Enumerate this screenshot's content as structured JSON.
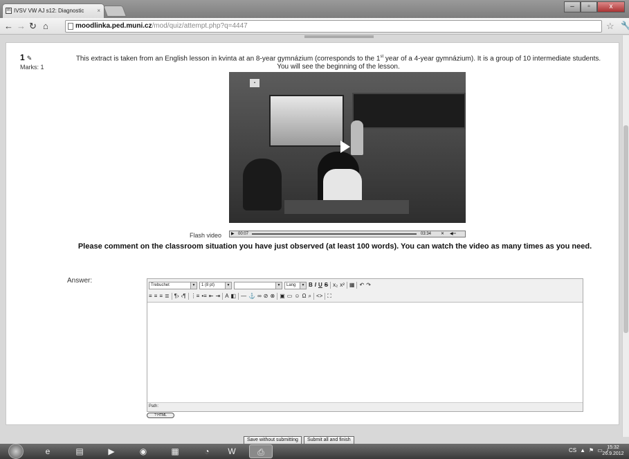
{
  "browser": {
    "tab_title": "IVSV VW AJ s12: Diagnostic",
    "tab_close": "×",
    "url_host": "moodlinka.ped.muni.cz",
    "url_path": "/mod/quiz/attempt.php?q=4447",
    "window_buttons": [
      "–",
      "▫",
      "x"
    ]
  },
  "question": {
    "number": "1",
    "flag": "✎",
    "marks": "Marks: 1",
    "intro_before_sup": "This extract is taken from an English lesson in kvinta at an 8-year gymnázium (corresponds to the 1",
    "intro_sup": "st",
    "intro_after_sup": " year of a 4-year gymnázium). It is a group of 10 intermediate students. You will see the beginning of the lesson.",
    "video_label": "Flash video",
    "video_time_current": "00:07",
    "video_time_total": "03:34",
    "prompt": "Please comment on the classroom situation you have just observed (at least 100 words). You can watch the video as many times as you need.",
    "answer_label": "Answer:"
  },
  "editor": {
    "font": "Trebuchet",
    "size": "1 (8 pt)",
    "style": "",
    "lang": "Lang",
    "path_label": "Path:",
    "help_label": "? HTML"
  },
  "buttons": {
    "save": "Save without submitting",
    "submit": "Submit all and finish"
  },
  "taskbar": {
    "language": "CS",
    "time": "15:32",
    "date": "26.9.2012"
  }
}
